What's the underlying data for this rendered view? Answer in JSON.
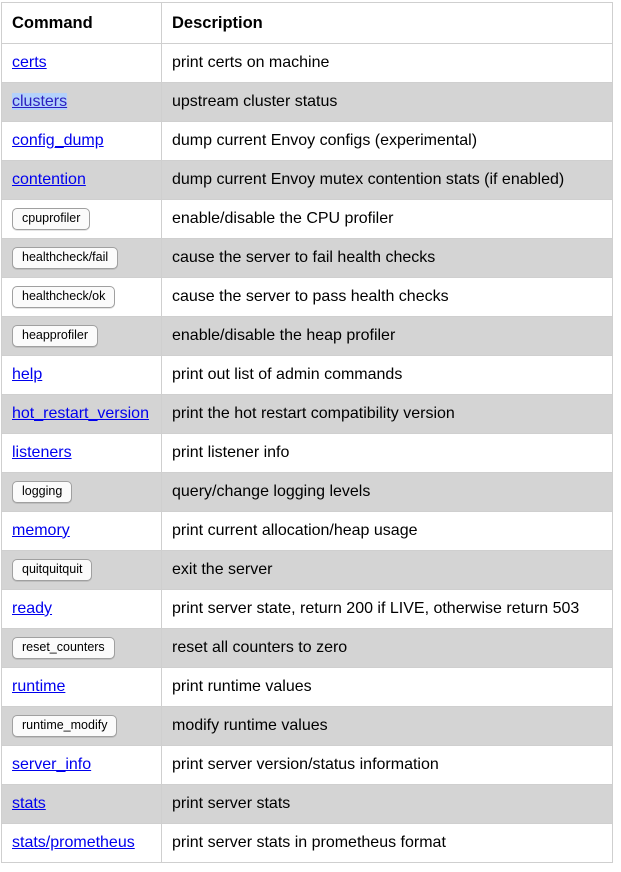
{
  "table": {
    "headers": {
      "command": "Command",
      "description": "Description"
    },
    "rows": [
      {
        "type": "link",
        "command": "certs",
        "description": "print certs on machine",
        "selected": false
      },
      {
        "type": "link",
        "command": "clusters",
        "description": "upstream cluster status",
        "selected": true
      },
      {
        "type": "link",
        "command": "config_dump",
        "description": "dump current Envoy configs (experimental)",
        "selected": false
      },
      {
        "type": "link",
        "command": "contention",
        "description": "dump current Envoy mutex contention stats (if enabled)",
        "selected": false
      },
      {
        "type": "button",
        "command": "cpuprofiler",
        "description": "enable/disable the CPU profiler",
        "selected": false
      },
      {
        "type": "button",
        "command": "healthcheck/fail",
        "description": "cause the server to fail health checks",
        "selected": false
      },
      {
        "type": "button",
        "command": "healthcheck/ok",
        "description": "cause the server to pass health checks",
        "selected": false
      },
      {
        "type": "button",
        "command": "heapprofiler",
        "description": "enable/disable the heap profiler",
        "selected": false
      },
      {
        "type": "link",
        "command": "help",
        "description": "print out list of admin commands",
        "selected": false
      },
      {
        "type": "link",
        "command": "hot_restart_version",
        "description": "print the hot restart compatibility version",
        "selected": false
      },
      {
        "type": "link",
        "command": "listeners",
        "description": "print listener info",
        "selected": false
      },
      {
        "type": "button",
        "command": "logging",
        "description": "query/change logging levels",
        "selected": false
      },
      {
        "type": "link",
        "command": "memory",
        "description": "print current allocation/heap usage",
        "selected": false
      },
      {
        "type": "button",
        "command": "quitquitquit",
        "description": "exit the server",
        "selected": false
      },
      {
        "type": "link",
        "command": "ready",
        "description": "print server state, return 200 if LIVE, otherwise return 503",
        "selected": false
      },
      {
        "type": "button",
        "command": "reset_counters",
        "description": "reset all counters to zero",
        "selected": false
      },
      {
        "type": "link",
        "command": "runtime",
        "description": "print runtime values",
        "selected": false
      },
      {
        "type": "button",
        "command": "runtime_modify",
        "description": "modify runtime values",
        "selected": false
      },
      {
        "type": "link",
        "command": "server_info",
        "description": "print server version/status information",
        "selected": false
      },
      {
        "type": "link",
        "command": "stats",
        "description": "print server stats",
        "selected": false
      },
      {
        "type": "link",
        "command": "stats/prometheus",
        "description": "print server stats in prometheus format",
        "selected": false
      }
    ]
  },
  "colors": {
    "link": "#0000ee",
    "selection_highlight": "#b4d2fb",
    "row_stripe": "#d4d4d4",
    "border": "#cfcfcf"
  }
}
